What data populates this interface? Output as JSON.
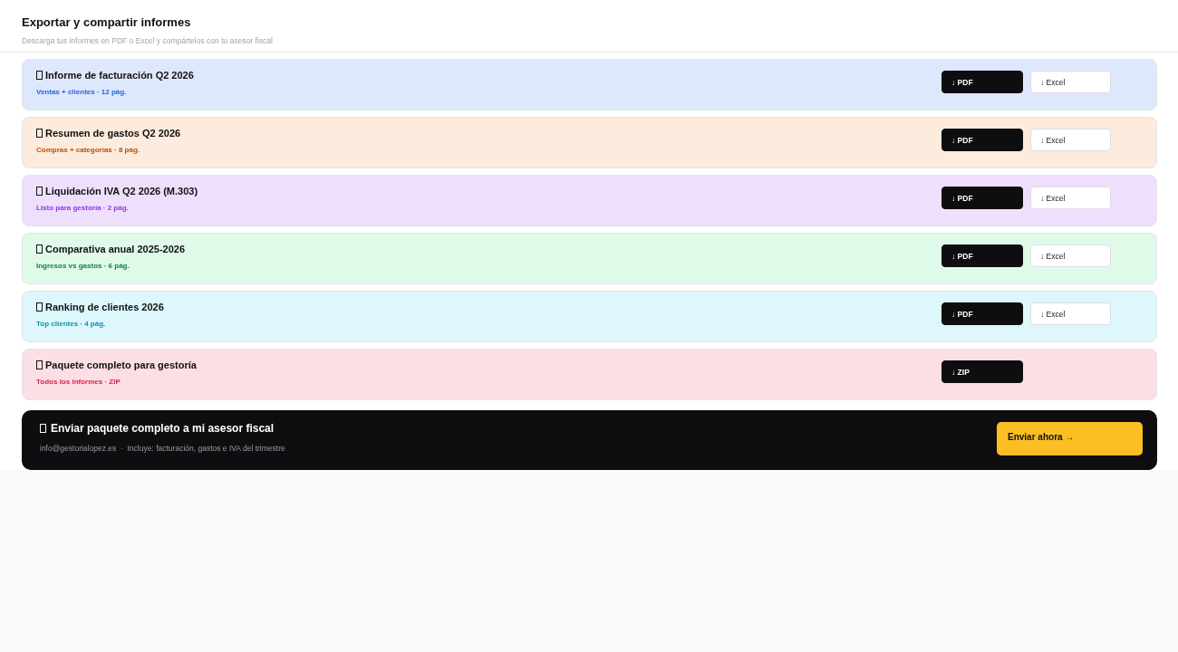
{
  "header": {
    "title": "Exportar y compartir informes",
    "subtitle": "Descarga tus informes en PDF o Excel y compártelos con tu asesor fiscal"
  },
  "reports": [
    {
      "title": "Informe de facturación Q2 2026",
      "detail": "Ventas + clientes · 12 pág.",
      "color": "#2563eb",
      "buttons": [
        {
          "label": "↓ PDF",
          "kind": "primary"
        },
        {
          "label": "↓ Excel",
          "kind": "secondary"
        }
      ]
    },
    {
      "title": "Resumen de gastos Q2 2026",
      "detail": "Compras + categorías · 8 pág.",
      "color": "#b45309",
      "buttons": [
        {
          "label": "↓ PDF",
          "kind": "primary"
        },
        {
          "label": "↓ Excel",
          "kind": "secondary"
        }
      ]
    },
    {
      "title": "Liquidación IVA Q2 2026 (M.303)",
      "detail": "Listo para gestoría · 2 pág.",
      "color": "#9333ea",
      "buttons": [
        {
          "label": "↓ PDF",
          "kind": "primary"
        },
        {
          "label": "↓ Excel",
          "kind": "secondary"
        }
      ]
    },
    {
      "title": "Comparativa anual 2025-2026",
      "detail": "Ingresos vs gastos · 6 pág.",
      "color": "#15803d",
      "buttons": [
        {
          "label": "↓ PDF",
          "kind": "primary"
        },
        {
          "label": "↓ Excel",
          "kind": "secondary"
        }
      ]
    },
    {
      "title": "Ranking de clientes 2026",
      "detail": "Top clientes · 4 pág.",
      "color": "#0891b2",
      "buttons": [
        {
          "label": "↓ PDF",
          "kind": "primary"
        },
        {
          "label": "↓ Excel",
          "kind": "secondary"
        }
      ]
    },
    {
      "title": "Paquete completo para gestoría",
      "detail": "Todos los informes · ZIP",
      "color": "#e11d48",
      "buttons": [
        {
          "label": "↓ ZIP",
          "kind": "primary"
        }
      ]
    }
  ],
  "send_panel": {
    "title": "Enviar paquete completo a mi asesor fiscal",
    "detail": "info@gestorialopez.es  ·  Incluye: facturación, gastos e IVA del trimestre",
    "button": "Enviar ahora →"
  }
}
